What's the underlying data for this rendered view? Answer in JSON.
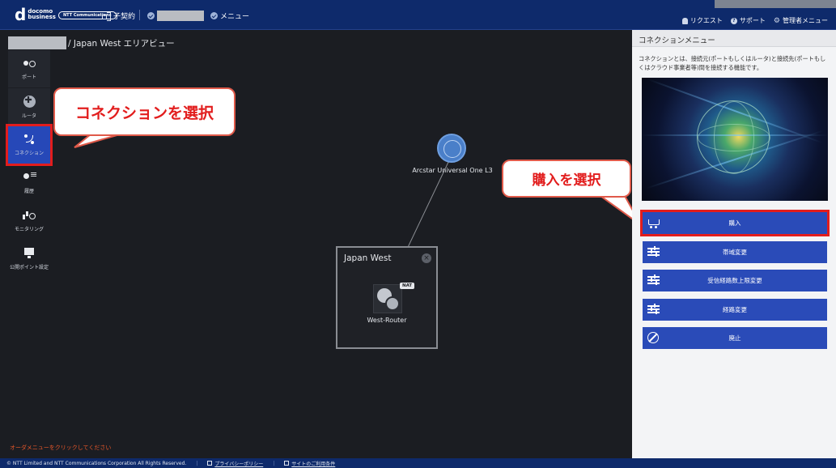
{
  "header": {
    "brand_top": "docomo",
    "brand_bottom": "business",
    "ntt_label": "NTT Communications",
    "contract_label": "子契約",
    "menu_label": "メニュー",
    "links": [
      "リクエスト",
      "サポート",
      "管理者メニュー"
    ]
  },
  "breadcrumb": {
    "text": "/ Japan West エリアビュー"
  },
  "leftnav": {
    "items": [
      {
        "label": "ポート",
        "icon": "port-icon"
      },
      {
        "label": "ルータ",
        "icon": "router-icon"
      },
      {
        "label": "コネクション",
        "icon": "connection-icon",
        "active": true
      },
      {
        "label": "履歴",
        "icon": "history-icon"
      },
      {
        "label": "モニタリング",
        "icon": "monitoring-icon"
      },
      {
        "label": "公開ポイント設定",
        "icon": "public-point-icon"
      }
    ]
  },
  "canvas": {
    "cloud_label": "Arcstar Universal One L3",
    "region_title": "Japan West",
    "router_label": "West-Router",
    "nat_badge": "NAT"
  },
  "callouts": {
    "connection": "コネクションを選択",
    "purchase": "購入を選択"
  },
  "order_hint": "オーダメニューをクリックしてください",
  "right_panel": {
    "title": "コネクションメニュー",
    "description": "コネクションとは、接続元(ポートもしくはルータ)と接続先(ポートもしくはクラウド事業者等)間を接続する機能です。",
    "buttons": [
      "購入",
      "帯域変更",
      "受信経路数上限変更",
      "経路変更",
      "廃止"
    ]
  },
  "footer": {
    "copyright": "© NTT Limited and NTT Communications Corporation All Rights Reserved.",
    "privacy": "プライバシーポリシー",
    "terms": "サイトのご利用条件"
  },
  "colors": {
    "header_bg": "#0e2a6b",
    "accent_blue": "#2a4bb8",
    "highlight_red": "#e21d1d",
    "canvas_bg": "#1b1d22"
  }
}
